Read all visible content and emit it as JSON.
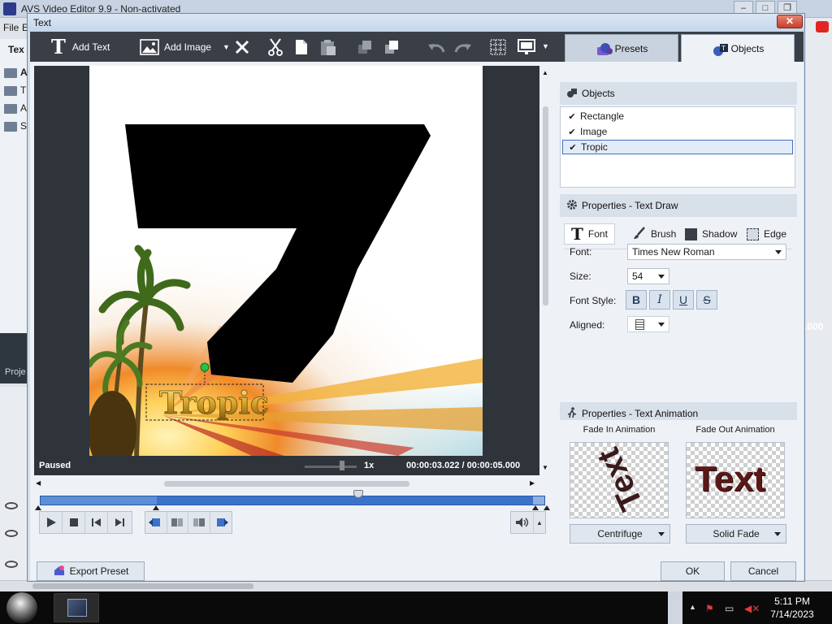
{
  "background_app": {
    "title": "AVS Video Editor 9.9 - Non-activated",
    "menu": [
      "File",
      "E"
    ],
    "side_tab": "Tex",
    "folders": [
      "A",
      "T",
      "A",
      "S"
    ],
    "project_label": "Proje",
    "right_time": ".000"
  },
  "dialog": {
    "title": "Text",
    "close_label": "✕"
  },
  "toolbar": {
    "add_text_label": "Add Text",
    "add_image_label": "Add Image"
  },
  "tabs": {
    "presets_label": "Presets",
    "objects_label": "Objects"
  },
  "preview": {
    "canvas_text": "Tropic",
    "status": "Paused",
    "speed": "1x",
    "current_time": "00:00:03.022",
    "separator": "/",
    "total_time": "00:00:05.000",
    "timeline_position": 0.63
  },
  "objects_panel": {
    "header": "Objects",
    "items": [
      {
        "label": "Rectangle",
        "checked": true,
        "selected": false
      },
      {
        "label": "Image",
        "checked": true,
        "selected": false
      },
      {
        "label": "Tropic",
        "checked": true,
        "selected": true
      }
    ]
  },
  "properties_text_draw": {
    "header": "Properties - Text Draw",
    "subtabs": [
      "Font",
      "Brush",
      "Shadow",
      "Edge"
    ],
    "active_subtab": "Font",
    "font_label": "Font:",
    "font_value": "Times New Roman",
    "size_label": "Size:",
    "size_value": "54",
    "style_label": "Font Style:",
    "style_buttons": [
      "B",
      "I",
      "U",
      "S"
    ],
    "aligned_label": "Aligned:"
  },
  "properties_text_animation": {
    "header": "Properties - Text Animation",
    "fade_in_label": "Fade In Animation",
    "fade_out_label": "Fade Out Animation",
    "fade_in_preview_text": "Text",
    "fade_out_preview_text": "Text",
    "fade_in_value": "Centrifuge",
    "fade_out_value": "Solid Fade"
  },
  "footer": {
    "export_preset_label": "Export Preset",
    "ok_label": "OK",
    "cancel_label": "Cancel"
  },
  "taskbar": {
    "time": "5:11 PM",
    "date": "7/14/2023"
  },
  "colors": {
    "toolbar_bg": "#3a3f47",
    "timeline_blue": "#3c73c9",
    "dialog_close_red": "#c6402a"
  }
}
